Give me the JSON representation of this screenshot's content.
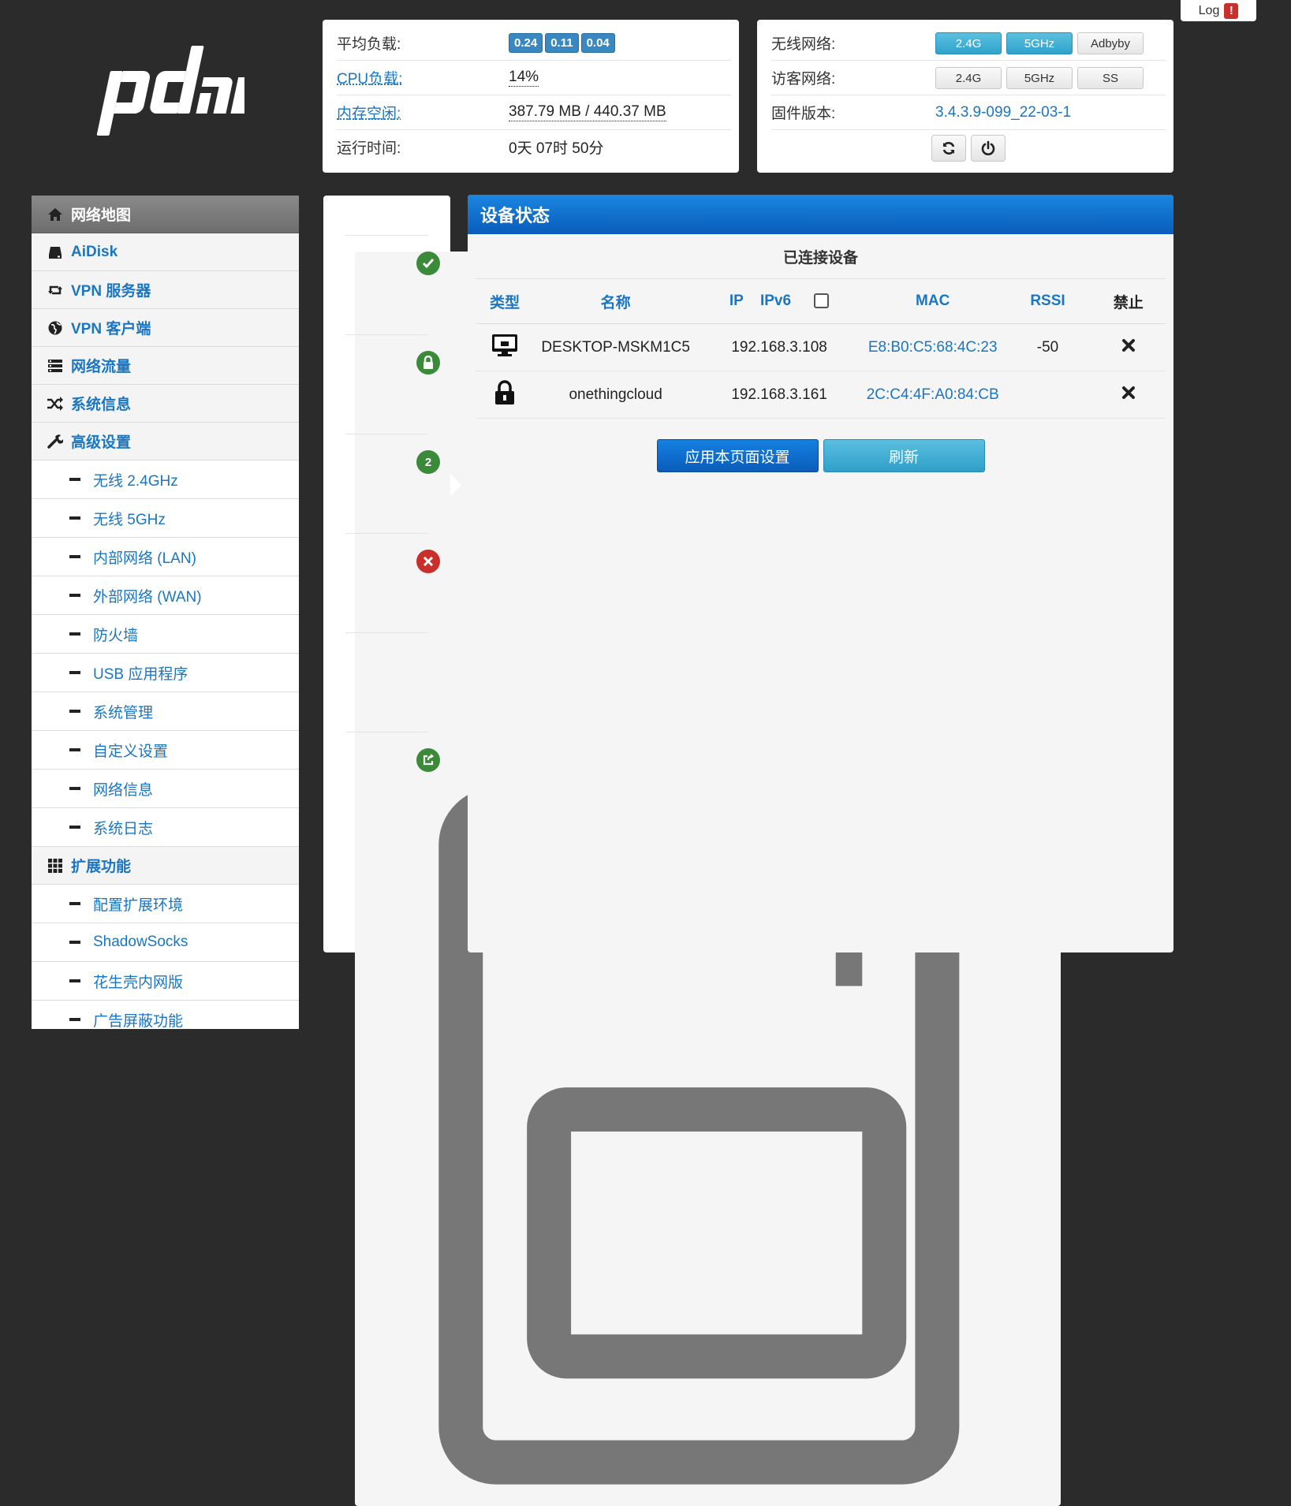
{
  "logo": {
    "text": "pdan"
  },
  "log": {
    "label": "Log",
    "alert": "!"
  },
  "system": {
    "load_label": "平均负载:",
    "load_values": [
      "0.24",
      "0.11",
      "0.04"
    ],
    "cpu_label": "CPU负载:",
    "cpu_value": "14%",
    "mem_label": "内存空闲:",
    "mem_value": "387.79 MB / 440.37 MB",
    "uptime_label": "运行时间:",
    "uptime_value": "0天 07时 50分"
  },
  "wireless": {
    "wifi_label": "无线网络:",
    "wifi_buttons": [
      "2.4G",
      "5GHz",
      "Adbyby"
    ],
    "guest_label": "访客网络:",
    "guest_buttons": [
      "2.4G",
      "5GHz",
      "SS"
    ],
    "fw_label": "固件版本:",
    "fw_value": "3.4.3.9-099_22-03-1"
  },
  "sidebar": {
    "items": [
      {
        "label": "网络地图",
        "icon": "home-icon",
        "active": true
      },
      {
        "label": "AiDisk",
        "icon": "disk-icon"
      },
      {
        "label": "VPN 服务器",
        "icon": "retweet-icon"
      },
      {
        "label": "VPN 客户端",
        "icon": "globe-icon"
      },
      {
        "label": "网络流量",
        "icon": "list-icon"
      },
      {
        "label": "系统信息",
        "icon": "shuffle-icon"
      },
      {
        "label": "高级设置",
        "icon": "wrench-icon"
      }
    ],
    "advanced": [
      "无线 2.4GHz",
      "无线 5GHz",
      "内部网络 (LAN)",
      "外部网络 (WAN)",
      "防火墙",
      "USB 应用程序",
      "系统管理",
      "自定义设置",
      "网络信息",
      "系统日志"
    ],
    "ext_label": "扩展功能",
    "ext_icon": "grid-icon",
    "extensions": [
      "配置扩展环境",
      "ShadowSocks",
      "花生壳内网版",
      "广告屏蔽功能"
    ]
  },
  "status_icons": {
    "clients_count": "2"
  },
  "main": {
    "title": "设备状态",
    "subtitle": "已连接设备",
    "headers": {
      "type": "类型",
      "name": "名称",
      "ip": "IP",
      "ipv6": "IPv6",
      "mac": "MAC",
      "rssi": "RSSI",
      "block": "禁止"
    },
    "rows": [
      {
        "icon": "desktop-icon",
        "name": "DESKTOP-MSKM1C5",
        "ip": "192.168.3.108",
        "mac": "E8:B0:C5:68:4C:23",
        "rssi": "-50"
      },
      {
        "icon": "lock-icon",
        "name": "onethingcloud",
        "ip": "192.168.3.161",
        "mac": "2C:C4:4F:A0:84:CB",
        "rssi": ""
      }
    ],
    "apply_label": "应用本页面设置",
    "refresh_label": "刷新"
  },
  "colors": {
    "accent": "#1a76c2",
    "header_blue": "#0a5cba",
    "badge": "#3a88c2",
    "ok_green": "#3a8a3a",
    "err_red": "#c9302c"
  }
}
